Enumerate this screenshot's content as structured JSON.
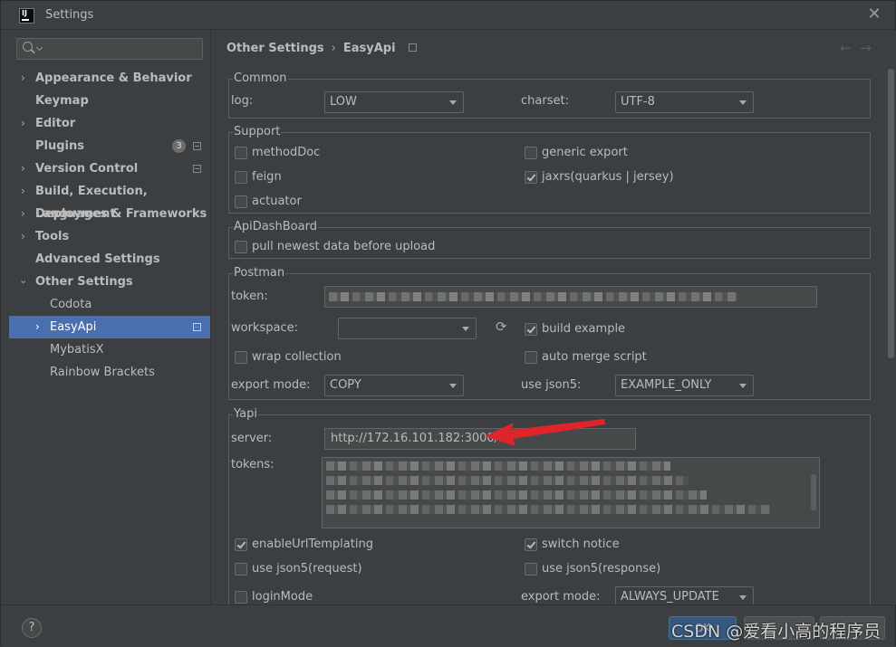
{
  "window": {
    "title": "Settings",
    "logo_text": "IJ"
  },
  "search": {
    "placeholder": ""
  },
  "sidebar": {
    "items": [
      {
        "label": "Appearance & Behavior"
      },
      {
        "label": "Keymap"
      },
      {
        "label": "Editor"
      },
      {
        "label": "Plugins",
        "badge": "3"
      },
      {
        "label": "Version Control"
      },
      {
        "label": "Build, Execution, Deployment"
      },
      {
        "label": "Languages & Frameworks"
      },
      {
        "label": "Tools"
      },
      {
        "label": "Advanced Settings"
      },
      {
        "label": "Other Settings"
      },
      {
        "label": "Codota"
      },
      {
        "label": "EasyApi"
      },
      {
        "label": "MybatisX"
      },
      {
        "label": "Rainbow Brackets"
      }
    ]
  },
  "breadcrumb": {
    "parent": "Other Settings",
    "separator": "›",
    "current": "EasyApi"
  },
  "common": {
    "title": "Common",
    "log_label": "log:",
    "log_value": "LOW",
    "charset_label": "charset:",
    "charset_value": "UTF-8"
  },
  "support": {
    "title": "Support",
    "methodDoc": {
      "label": "methodDoc",
      "checked": false
    },
    "feign": {
      "label": "feign",
      "checked": false
    },
    "actuator": {
      "label": "actuator",
      "checked": false
    },
    "generic_export": {
      "label": "generic export",
      "checked": false
    },
    "jaxrs": {
      "label": "jaxrs(quarkus | jersey)",
      "checked": true
    }
  },
  "dashboard": {
    "title": "ApiDashBoard",
    "pull": {
      "label": "pull newest data before upload",
      "checked": false
    }
  },
  "postman": {
    "title": "Postman",
    "token_label": "token:",
    "workspace_label": "workspace:",
    "workspace_value": "",
    "build_example": {
      "label": "build example",
      "checked": true
    },
    "wrap_collection": {
      "label": "wrap collection",
      "checked": false
    },
    "auto_merge": {
      "label": "auto merge script",
      "checked": false
    },
    "export_mode_label": "export mode:",
    "export_mode_value": "COPY",
    "use_json5_label": "use json5:",
    "use_json5_value": "EXAMPLE_ONLY"
  },
  "yapi": {
    "title": "Yapi",
    "server_label": "server:",
    "server_value": "http://172.16.101.182:3000/",
    "tokens_label": "tokens:",
    "enableUrlTemplating": {
      "label": "enableUrlTemplating",
      "checked": true
    },
    "switch_notice": {
      "label": "switch notice",
      "checked": true
    },
    "use_json5_request": {
      "label": "use json5(request)",
      "checked": false
    },
    "use_json5_response": {
      "label": "use json5(response)",
      "checked": false
    },
    "loginMode": {
      "label": "loginMode",
      "checked": false
    },
    "export_mode_label": "export mode:",
    "export_mode_value": "ALWAYS_UPDATE"
  },
  "footer": {
    "help": "?",
    "ok_label": "OK",
    "watermark": "CSDN @爱看小高的程序员"
  },
  "colors": {
    "accent": "#4b6eaf",
    "arrow": "#e0242b",
    "background": "#3c3f41"
  }
}
